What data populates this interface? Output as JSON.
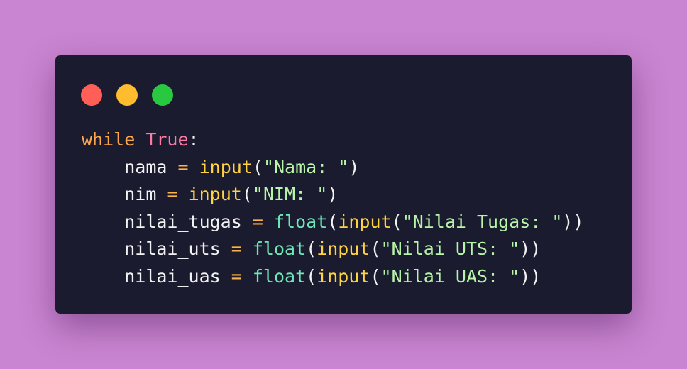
{
  "colors": {
    "background": "#c985d1",
    "window": "#1b1b2f",
    "close": "#ff5f57",
    "minimize": "#febc2e",
    "maximize": "#28c840"
  },
  "window_controls": [
    "close",
    "minimize",
    "maximize"
  ],
  "code": {
    "line1": {
      "kw": "while",
      "const": "True",
      "colon": ":"
    },
    "line2": {
      "indent": "    ",
      "var": "nama",
      "eq": "=",
      "fn": "input",
      "open": "(",
      "str": "\"Nama: \"",
      "close": ")"
    },
    "line3": {
      "indent": "    ",
      "var": "nim",
      "eq": "=",
      "fn": "input",
      "open": "(",
      "str": "\"NIM: \"",
      "close": ")"
    },
    "line4": {
      "indent": "    ",
      "var": "nilai_tugas",
      "eq": "=",
      "fn_outer": "float",
      "open1": "(",
      "fn_inner": "input",
      "open2": "(",
      "str": "\"Nilai Tugas: \"",
      "close": "))"
    },
    "line5": {
      "indent": "    ",
      "var": "nilai_uts",
      "eq": "=",
      "fn_outer": "float",
      "open1": "(",
      "fn_inner": "input",
      "open2": "(",
      "str": "\"Nilai UTS: \"",
      "close": "))"
    },
    "line6": {
      "indent": "    ",
      "var": "nilai_uas",
      "eq": "=",
      "fn_outer": "float",
      "open1": "(",
      "fn_inner": "input",
      "open2": "(",
      "str": "\"Nilai UAS: \"",
      "close": "))"
    }
  }
}
